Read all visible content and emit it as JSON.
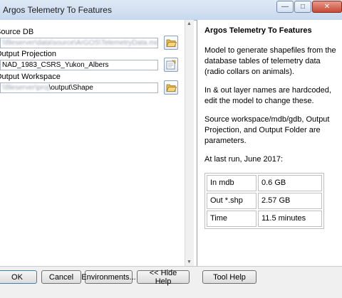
{
  "window": {
    "title": "Argos Telemetry To Features",
    "minimize_glyph": "—",
    "maximize_glyph": "□",
    "close_glyph": "✕"
  },
  "form": {
    "source_db": {
      "label": "Source DB",
      "value": "\\\\fileserver\\data\\source\\ArGOS\\TelemetryData.mdb"
    },
    "output_projection": {
      "label": "Output Projection",
      "value": "NAD_1983_CSRS_Yukon_Albers"
    },
    "output_workspace": {
      "label": "Output Workspace",
      "value_hidden": "\\\\fileserver\\proj",
      "value_visible": "\\output\\Shape"
    }
  },
  "help": {
    "title": "Argos Telemetry To Features",
    "paragraphs": [
      "Model to generate shapefiles from the database tables of telemetry data (radio collars on animals).",
      "In & out layer names are hardcoded, edit the model to change these.",
      "Source workspace/mdb/gdb, Output Projection, and Output Folder are parameters.",
      "At last run, June 2017:"
    ],
    "stats": [
      {
        "key": "In mdb",
        "value": "0.6 GB"
      },
      {
        "key": "Out *.shp",
        "value": "2.57 GB"
      },
      {
        "key": "Time",
        "value": "11.5 minutes"
      }
    ]
  },
  "buttons": {
    "ok": "OK",
    "cancel": "Cancel",
    "environments": "Environments...",
    "hide_help": "<< Hide Help",
    "tool_help": "Tool Help"
  },
  "icons": {
    "browse_folder": "folder-open-icon",
    "spatial_reference": "spatial-reference-icon"
  }
}
